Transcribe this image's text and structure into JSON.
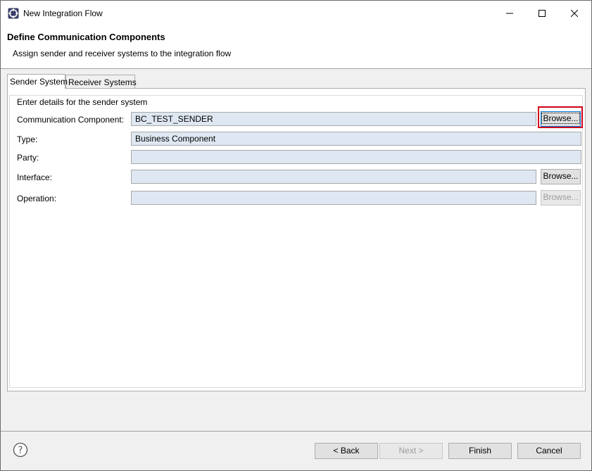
{
  "window": {
    "title": "New Integration Flow"
  },
  "header": {
    "title": "Define Communication Components",
    "subtitle": "Assign sender and receiver systems to the integration flow"
  },
  "tabs": [
    {
      "label": "Sender System",
      "active": true
    },
    {
      "label": "Receiver Systems",
      "active": false
    }
  ],
  "group": {
    "legend": "Enter details for the sender system"
  },
  "form": {
    "communication_component": {
      "label": "Communication Component:",
      "value": "BC_TEST_SENDER"
    },
    "type": {
      "label": "Type:",
      "value": "Business Component"
    },
    "party": {
      "label": "Party:",
      "value": ""
    },
    "interface": {
      "label": "Interface:",
      "value": ""
    },
    "operation": {
      "label": "Operation:",
      "value": ""
    },
    "browse_label": "Browse..."
  },
  "footer": {
    "back_label": "< Back",
    "next_label": "Next >",
    "finish_label": "Finish",
    "cancel_label": "Cancel"
  },
  "colors": {
    "highlight": "#d0021b",
    "field_bg": "#dee7f2"
  }
}
